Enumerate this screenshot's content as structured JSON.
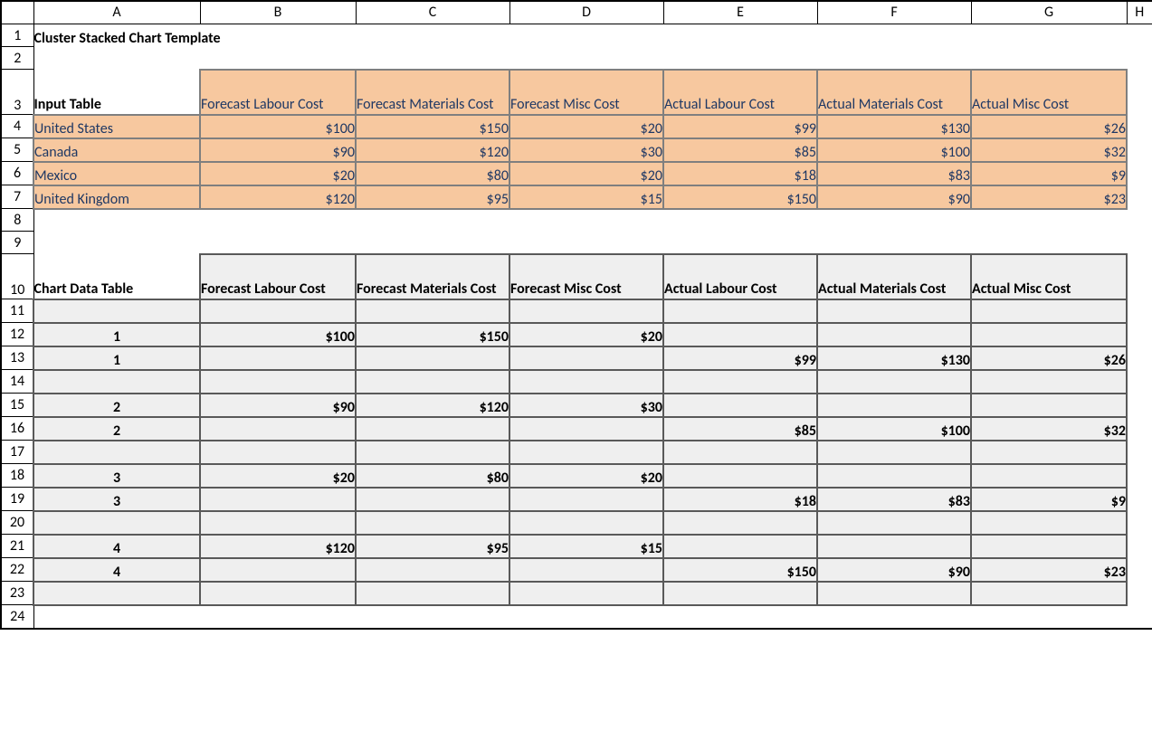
{
  "columns": [
    "A",
    "B",
    "C",
    "D",
    "E",
    "F",
    "G",
    "H"
  ],
  "rows": [
    "1",
    "2",
    "3",
    "4",
    "5",
    "6",
    "7",
    "8",
    "9",
    "10",
    "11",
    "12",
    "13",
    "14",
    "15",
    "16",
    "17",
    "18",
    "19",
    "20",
    "21",
    "22",
    "23",
    "24"
  ],
  "title": "Cluster Stacked Chart Template",
  "inputTable": {
    "label": "Input Table",
    "headers": [
      "Forecast Labour Cost",
      "Forecast Materials Cost",
      "Forecast Misc Cost",
      "Actual Labour Cost",
      "Actual Materials Cost",
      "Actual Misc Cost"
    ],
    "rows": [
      {
        "name": "United States",
        "values": [
          "$100",
          "$150",
          "$20",
          "$99",
          "$130",
          "$26"
        ]
      },
      {
        "name": "Canada",
        "values": [
          "$90",
          "$120",
          "$30",
          "$85",
          "$100",
          "$32"
        ]
      },
      {
        "name": "Mexico",
        "values": [
          "$20",
          "$80",
          "$20",
          "$18",
          "$83",
          "$9"
        ]
      },
      {
        "name": "United Kingdom",
        "values": [
          "$120",
          "$95",
          "$15",
          "$150",
          "$90",
          "$23"
        ]
      }
    ]
  },
  "chartTable": {
    "label": "Chart Data Table",
    "headers": [
      "Forecast Labour Cost",
      "Forecast Materials Cost",
      "Forecast Misc Cost",
      "Actual Labour Cost",
      "Actual Materials Cost",
      "Actual Misc Cost"
    ],
    "rows": [
      {
        "idx": "",
        "values": [
          "",
          "",
          "",
          "",
          "",
          ""
        ]
      },
      {
        "idx": "1",
        "values": [
          "$100",
          "$150",
          "$20",
          "",
          "",
          ""
        ]
      },
      {
        "idx": "1",
        "values": [
          "",
          "",
          "",
          "$99",
          "$130",
          "$26"
        ]
      },
      {
        "idx": "",
        "values": [
          "",
          "",
          "",
          "",
          "",
          ""
        ]
      },
      {
        "idx": "2",
        "values": [
          "$90",
          "$120",
          "$30",
          "",
          "",
          ""
        ]
      },
      {
        "idx": "2",
        "values": [
          "",
          "",
          "",
          "$85",
          "$100",
          "$32"
        ]
      },
      {
        "idx": "",
        "values": [
          "",
          "",
          "",
          "",
          "",
          ""
        ]
      },
      {
        "idx": "3",
        "values": [
          "$20",
          "$80",
          "$20",
          "",
          "",
          ""
        ]
      },
      {
        "idx": "3",
        "values": [
          "",
          "",
          "",
          "$18",
          "$83",
          "$9"
        ]
      },
      {
        "idx": "",
        "values": [
          "",
          "",
          "",
          "",
          "",
          ""
        ]
      },
      {
        "idx": "4",
        "values": [
          "$120",
          "$95",
          "$15",
          "",
          "",
          ""
        ]
      },
      {
        "idx": "4",
        "values": [
          "",
          "",
          "",
          "$150",
          "$90",
          "$23"
        ]
      },
      {
        "idx": "",
        "values": [
          "",
          "",
          "",
          "",
          "",
          ""
        ]
      }
    ]
  }
}
